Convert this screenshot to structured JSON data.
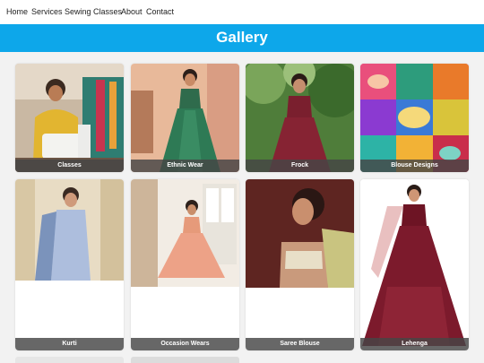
{
  "nav": {
    "items": [
      "Home",
      "Services",
      "Sewing Classes",
      "About",
      "Contact"
    ]
  },
  "banner": {
    "title": "Gallery",
    "color": "#0da7ea"
  },
  "gallery": {
    "items": [
      {
        "caption": "Classes",
        "image": "woman-at-sewing-machine"
      },
      {
        "caption": "Ethnic Wear",
        "image": "green-lehenga"
      },
      {
        "caption": "Frock",
        "image": "maroon-frock"
      },
      {
        "caption": "Blouse Designs",
        "image": "blouse-embroidery-collage"
      },
      {
        "caption": "Kurti",
        "image": "blue-printed-kurti"
      },
      {
        "caption": "Occasion Wears",
        "image": "peach-anarkali"
      },
      {
        "caption": "Saree Blouse",
        "image": "saree-blouse"
      },
      {
        "caption": "Lehenga",
        "image": "maroon-bridal-lehenga"
      }
    ]
  }
}
